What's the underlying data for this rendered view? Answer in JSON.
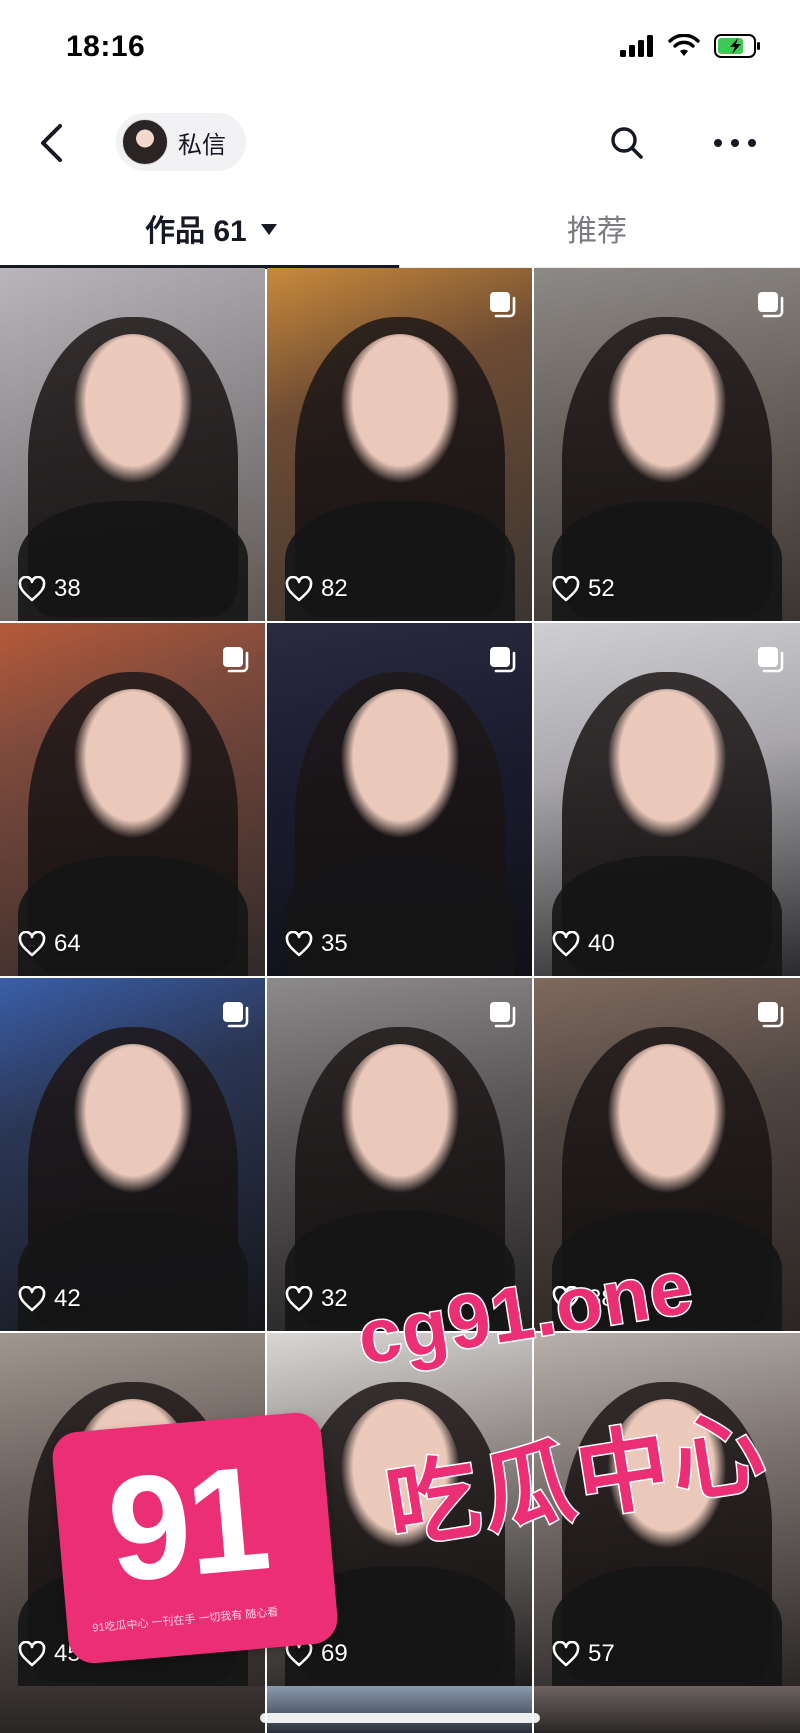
{
  "status_bar": {
    "time": "18:16"
  },
  "header": {
    "dm_label": "私信"
  },
  "tabs": {
    "works_label": "作品 61",
    "recommend_label": "推荐"
  },
  "grid": [
    {
      "likes": "38",
      "multi": false,
      "bg": "linear-gradient(160deg,#b9b6bb 0%,#8f8b8f 45%,#5e5753 100%)"
    },
    {
      "likes": "82",
      "multi": true,
      "bg": "linear-gradient(160deg,#c98a3b 0%,#6d4b33 35%,#3a3532 100%)"
    },
    {
      "likes": "52",
      "multi": true,
      "bg": "linear-gradient(170deg,#8d8986 0%,#6b6560 40%,#3b3430 100%)"
    },
    {
      "likes": "64",
      "multi": true,
      "bg": "linear-gradient(160deg,#b65a3a 0%,#7d4a3c 30%,#2f2a2a 100%)"
    },
    {
      "likes": "35",
      "multi": true,
      "bg": "linear-gradient(170deg,#2a2a40 0%,#1b1b2e 45%,#101018 100%)"
    },
    {
      "likes": "40",
      "multi": true,
      "bg": "linear-gradient(170deg,#cfcfd3 0%,#a9a7ab 40%,#2a2a2c 100%)"
    },
    {
      "likes": "42",
      "multi": true,
      "bg": "linear-gradient(160deg,#3a5ea8 0%,#2b3654 35%,#151618 100%)"
    },
    {
      "likes": "32",
      "multi": true,
      "bg": "linear-gradient(170deg,#8d8a8c 0%,#5c5859 40%,#222122 100%)"
    },
    {
      "likes": "38",
      "multi": true,
      "bg": "linear-gradient(170deg,#7e6a5e 0%,#4e4440 40%,#2b2523 100%)"
    },
    {
      "likes": "45",
      "multi": false,
      "bg": "linear-gradient(170deg,#a09791 0%,#6d625d 40%,#2f2a28 100%)"
    },
    {
      "likes": "69",
      "multi": false,
      "bg": "linear-gradient(170deg,#d9d6d4 0%,#8d8784 40%,#1e1c1c 100%)"
    },
    {
      "likes": "57",
      "multi": false,
      "bg": "linear-gradient(170deg,#b7b0ab 0%,#7b726e 40%,#2a2626 100%)"
    }
  ],
  "watermark": {
    "badge_number": "91",
    "badge_small_text": "91吃瓜中心 一刊在手 一切我有 随心看",
    "domain": "cg91.one",
    "chinese": "吃瓜中心",
    "color": "#ec2f75"
  },
  "colors": {
    "text_primary": "#161823",
    "text_secondary": "#7a7a80"
  },
  "icons": [
    "back-icon",
    "search-icon",
    "more-icon",
    "multi-image-icon",
    "heart-icon",
    "signal-icon",
    "wifi-icon",
    "battery-icon"
  ]
}
